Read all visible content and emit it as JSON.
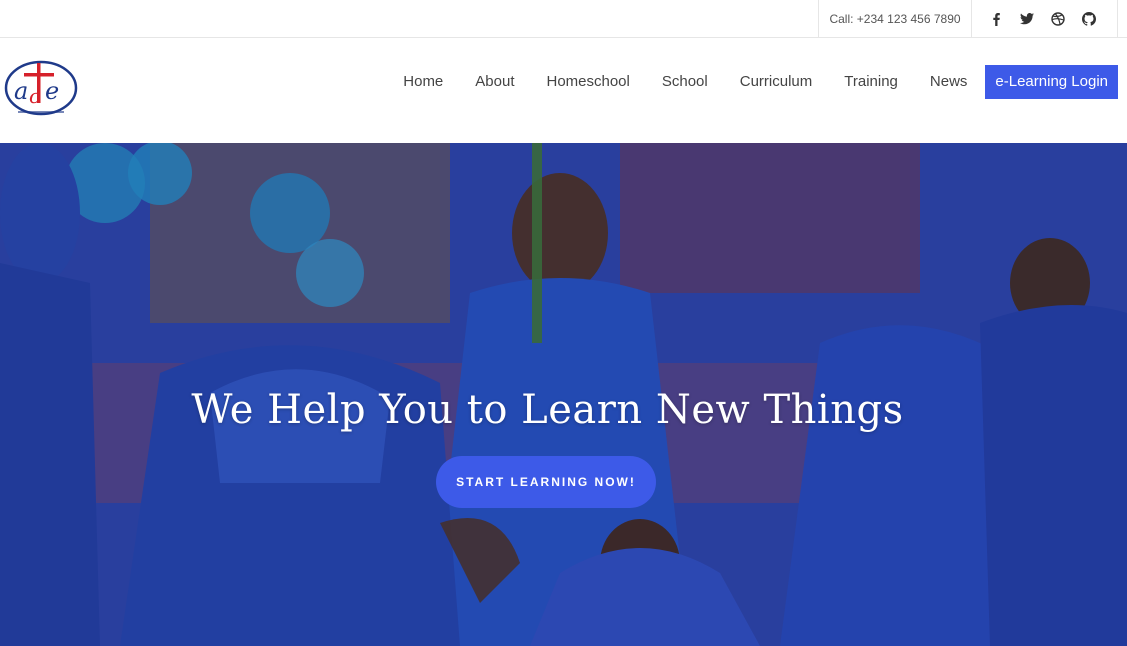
{
  "topbar": {
    "call": "Call: +234 123 456 7890",
    "socials": [
      {
        "icon": "facebook-icon"
      },
      {
        "icon": "twitter-icon"
      },
      {
        "icon": "dribbble-icon"
      },
      {
        "icon": "github-icon"
      }
    ]
  },
  "brand": {
    "logo_text": "ace",
    "colors": {
      "red": "#d6202a",
      "blue": "#1f3a8a"
    }
  },
  "nav": {
    "items": [
      "Home",
      "About",
      "Homeschool",
      "School",
      "Curriculum",
      "Training",
      "News"
    ],
    "cta": "e-Learning Login"
  },
  "hero": {
    "title": "We Help You to Learn New Things",
    "button": "START LEARNING NOW!"
  },
  "colors": {
    "accent": "#3d5ae8",
    "text": "#444444",
    "border": "#e6e6e6"
  }
}
